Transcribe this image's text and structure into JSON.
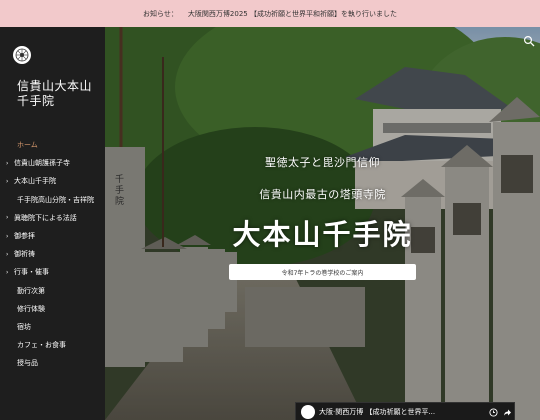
{
  "notice": {
    "label": "お知らせ：",
    "text": "大阪関西万博2025 【成功祈願と世界平和祈願】を執り行いました"
  },
  "site": {
    "title": "信貴山大本山千手院"
  },
  "nav": {
    "items": [
      {
        "label": "ホーム",
        "active": true,
        "type": "home"
      },
      {
        "label": "信貴山朝護孫子寺",
        "type": "parent"
      },
      {
        "label": "大本山千手院",
        "type": "parent"
      },
      {
        "label": "千手院高山分院・吉祥院",
        "type": "child"
      },
      {
        "label": "眞聴院下による法話",
        "type": "parent"
      },
      {
        "label": "御参拝",
        "type": "parent"
      },
      {
        "label": "御祈祷",
        "type": "parent"
      },
      {
        "label": "行事・催事",
        "type": "parent"
      },
      {
        "label": "勤行次第",
        "type": "child"
      },
      {
        "label": "修行体験",
        "type": "child"
      },
      {
        "label": "宿坊",
        "type": "child"
      },
      {
        "label": "カフェ・お食事",
        "type": "child"
      },
      {
        "label": "授与品",
        "type": "child"
      }
    ]
  },
  "hero": {
    "tagline1": "聖徳太子と毘沙門信仰",
    "tagline2": "信貴山内最古の塔頭寺院",
    "title": "大本山千手院",
    "link": "令和7年トラの巻学校のご案内",
    "sign_text": "千手院"
  },
  "video": {
    "title": "大阪·関西万博 【成功祈願と世界平..."
  },
  "colors": {
    "notice_bg": "#f2c9cb",
    "sidebar_bg": "#1e1e1e",
    "active_nav": "#d89a6e"
  }
}
